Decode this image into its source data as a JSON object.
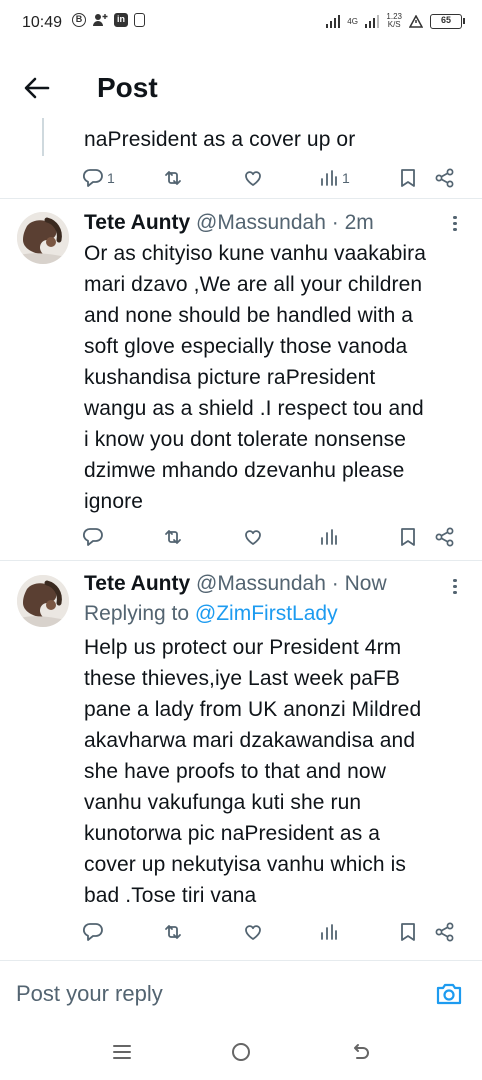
{
  "status_bar": {
    "time": "10:49",
    "left_icons": [
      "b-circle-icon",
      "person-plus-icon",
      "linkedin-icon",
      "sim-card-icon"
    ],
    "network_tag": "4G",
    "speed": "1.23",
    "speed_unit": "K/S",
    "battery": "65"
  },
  "header": {
    "title": "Post"
  },
  "thread_top": {
    "text": "naPresident as a cover up or",
    "reply_count": "1",
    "view_count": "1"
  },
  "tweets": [
    {
      "author": "Tete Aunty",
      "handle": "@Massundah",
      "separator": "·",
      "time": "2m",
      "lines": [
        "Or as chityiso kune vanhu vaakabira",
        "mari dzavo ,We are all your children",
        "and none should be handled with a",
        "soft glove especially those vanoda",
        "kushandisa picture raPresident",
        "wangu as a shield .I respect tou and",
        "i know you dont tolerate nonsense",
        "dzimwe mhando dzevanhu please",
        "ignore"
      ]
    },
    {
      "author": "Tete Aunty",
      "handle": "@Massundah",
      "separator": "·",
      "time": "Now",
      "replying_prefix": "Replying to",
      "replying_to": "@ZimFirstLady",
      "lines": [
        "Help us protect our President 4rm",
        "these thieves,iye Last week paFB",
        "pane a lady from UK anonzi Mildred",
        "akavharwa mari dzakawandisa and",
        "she have proofs to that and now",
        "vanhu vakufunga kuti she run",
        "kunotorwa pic naPresident as a",
        "cover up nekutyisa vanhu which is",
        "bad .Tose tiri vana"
      ]
    }
  ],
  "reply_box": {
    "placeholder": "Post your reply"
  },
  "colors": {
    "accent": "#1d9bf0",
    "text": "#0f1419",
    "secondary": "#536471",
    "divider": "#e6ebee"
  }
}
